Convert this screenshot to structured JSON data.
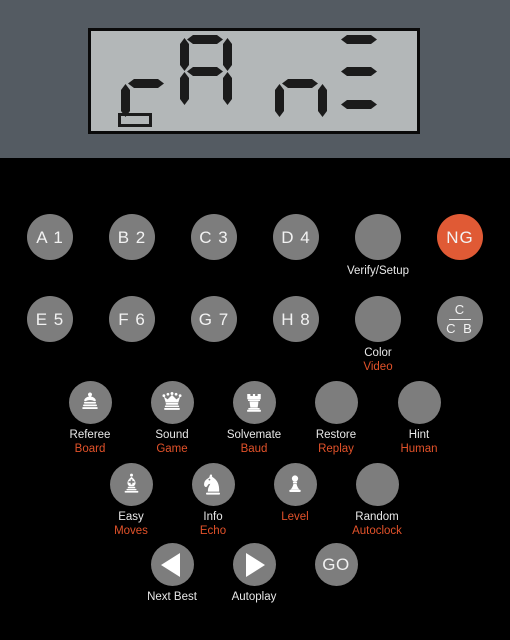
{
  "device": {
    "name": "chess-computer-keypad",
    "panel_color": "#545b62",
    "body_color": "#000000",
    "accent_color": "#e05a35",
    "button_color": "#7d7d7d",
    "label_color": "#e8e8e8"
  },
  "lcd": {
    "background": "#b3b7b8",
    "segment_color": "#1b1b1b",
    "text": "rA nE",
    "digits": [
      {
        "char": "r",
        "segments": [
          "e",
          "g"
        ]
      },
      {
        "char": "A",
        "segments": [
          "a",
          "b",
          "c",
          "e",
          "f",
          "g"
        ]
      },
      {
        "char": "n",
        "segments": [
          "c",
          "e",
          "g"
        ]
      },
      {
        "char": "E",
        "segments": [
          "a",
          "g",
          "d"
        ]
      }
    ],
    "indicator_box": "empty"
  },
  "keypad": {
    "rows": [
      {
        "name": "row-files-1",
        "keys": [
          {
            "id": "a1",
            "face": "A 1",
            "style": "big"
          },
          {
            "id": "b2",
            "face": "B 2",
            "style": "big"
          },
          {
            "id": "c3",
            "face": "C 3",
            "style": "big"
          },
          {
            "id": "d4",
            "face": "D 4",
            "style": "big"
          },
          {
            "id": "verify-setup",
            "face": "",
            "style": "big",
            "label_top": "Verify/Setup"
          },
          {
            "id": "ng",
            "face": "NG",
            "style": "big",
            "accent": true
          }
        ]
      },
      {
        "name": "row-files-2",
        "keys": [
          {
            "id": "e5",
            "face": "E 5",
            "style": "big"
          },
          {
            "id": "f6",
            "face": "F 6",
            "style": "big"
          },
          {
            "id": "g7",
            "face": "G 7",
            "style": "big"
          },
          {
            "id": "h8",
            "face": "H 8",
            "style": "big"
          },
          {
            "id": "color-video",
            "face": "",
            "style": "big",
            "label_top": "Color",
            "label_sub": "Video"
          },
          {
            "id": "cb",
            "face_top": "C",
            "face_bottom": "C B",
            "style": "big"
          }
        ]
      },
      {
        "name": "row-pieces-1",
        "keys": [
          {
            "id": "referee-board",
            "icon": "chess-king-icon",
            "label_top": "Referee",
            "label_sub": "Board"
          },
          {
            "id": "sound-game",
            "icon": "chess-queen-icon",
            "label_top": "Sound",
            "label_sub": "Game"
          },
          {
            "id": "solvemate-baud",
            "icon": "chess-rook-icon",
            "label_top": "Solvemate",
            "label_sub": "Baud"
          },
          {
            "id": "restore-replay",
            "icon": "",
            "label_top": "Restore",
            "label_sub": "Replay"
          },
          {
            "id": "hint-human",
            "icon": "",
            "label_top": "Hint",
            "label_sub": "Human"
          }
        ]
      },
      {
        "name": "row-pieces-2",
        "keys": [
          {
            "id": "easy-moves",
            "icon": "chess-bishop-icon",
            "label_top": "Easy",
            "label_sub": "Moves"
          },
          {
            "id": "info-echo",
            "icon": "chess-knight-icon",
            "label_top": "Info",
            "label_sub": "Echo"
          },
          {
            "id": "level",
            "icon": "chess-pawn-icon",
            "label_sub": "Level"
          },
          {
            "id": "random-autoclock",
            "icon": "",
            "label_top": "Random",
            "label_sub": "Autoclock"
          }
        ]
      },
      {
        "name": "row-transport",
        "keys": [
          {
            "id": "next-best",
            "icon": "triangle-left-icon",
            "label_top": "Next Best"
          },
          {
            "id": "autoplay",
            "icon": "triangle-right-icon",
            "label_top": "Autoplay"
          },
          {
            "id": "go",
            "face": "GO"
          }
        ]
      }
    ]
  }
}
